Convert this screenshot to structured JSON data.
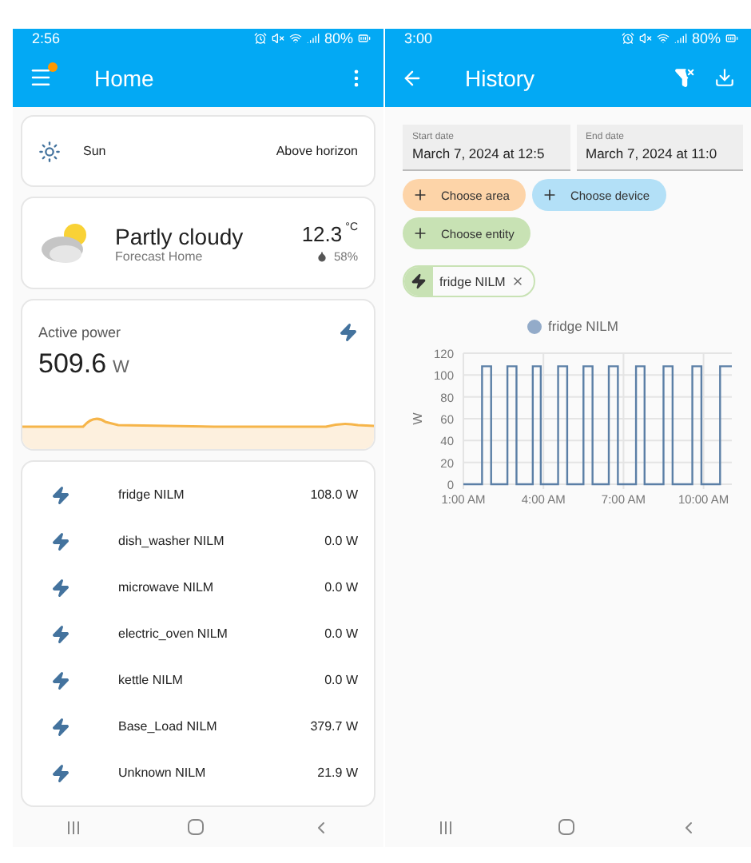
{
  "home_screen": {
    "status_bar": {
      "time": "2:56",
      "battery": "80%"
    },
    "app_bar": {
      "title": "Home"
    },
    "sun_card": {
      "name": "Sun",
      "state": "Above horizon"
    },
    "weather_card": {
      "condition": "Partly cloudy",
      "source": "Forecast Home",
      "temperature": "12.3",
      "unit": "°C",
      "humidity": "58%"
    },
    "power_card": {
      "title": "Active power",
      "value": "509.6",
      "unit": "W"
    },
    "entities": [
      {
        "name": "fridge NILM",
        "value": "108.0 W"
      },
      {
        "name": "dish_washer NILM",
        "value": "0.0 W"
      },
      {
        "name": "microwave NILM",
        "value": "0.0 W"
      },
      {
        "name": "electric_oven NILM",
        "value": "0.0 W"
      },
      {
        "name": "kettle NILM",
        "value": "0.0 W"
      },
      {
        "name": "Base_Load NILM",
        "value": "379.7 W"
      },
      {
        "name": "Unknown NILM",
        "value": "21.9 W"
      }
    ]
  },
  "history_screen": {
    "status_bar": {
      "time": "3:00",
      "battery": "80%"
    },
    "app_bar": {
      "title": "History"
    },
    "start_date": {
      "label": "Start date",
      "value": "March 7, 2024 at 12:5"
    },
    "end_date": {
      "label": "End date",
      "value": "March 7, 2024 at 11:0"
    },
    "chips": [
      {
        "label": "Choose area",
        "color": "#fdd4a8"
      },
      {
        "label": "Choose device",
        "color": "#b3e0f7"
      },
      {
        "label": "Choose entity",
        "color": "#c8e2b4"
      }
    ],
    "selected_entity": {
      "label": "fridge NILM"
    },
    "chart": {
      "chart_data": {
        "type": "line",
        "grid": true,
        "ylabel": "W",
        "xlim": [
          1,
          11.06
        ],
        "ylim": [
          0,
          120
        ],
        "xticks": [
          {
            "value": 1,
            "label": "1:00 AM"
          },
          {
            "value": 4,
            "label": "4:00 AM"
          },
          {
            "value": 7,
            "label": "7:00 AM"
          },
          {
            "value": 10,
            "label": "10:00 AM"
          }
        ],
        "yticks": [
          0,
          20,
          40,
          60,
          80,
          100,
          120
        ],
        "series": [
          {
            "name": "fridge NILM",
            "color": "#5b7fa6",
            "x": [
              1,
              1.7,
              1.7,
              2.04,
              2.04,
              2.65,
              2.65,
              2.99,
              2.99,
              3.6,
              3.6,
              3.9,
              3.9,
              4.55,
              4.55,
              4.89,
              4.89,
              5.5,
              5.5,
              5.84,
              5.84,
              6.45,
              6.45,
              6.79,
              6.79,
              7.47,
              7.47,
              7.79,
              7.79,
              8.5,
              8.5,
              8.84,
              8.84,
              9.58,
              9.58,
              9.92,
              9.92,
              10.62,
              10.62,
              11.06
            ],
            "values": [
              0,
              0,
              108,
              108,
              0,
              0,
              108,
              108,
              0,
              0,
              108,
              108,
              0,
              0,
              108,
              108,
              0,
              0,
              108,
              108,
              0,
              0,
              108,
              108,
              0,
              0,
              108,
              108,
              0,
              0,
              108,
              108,
              0,
              0,
              108,
              108,
              0,
              0,
              108,
              108
            ]
          }
        ]
      }
    }
  }
}
